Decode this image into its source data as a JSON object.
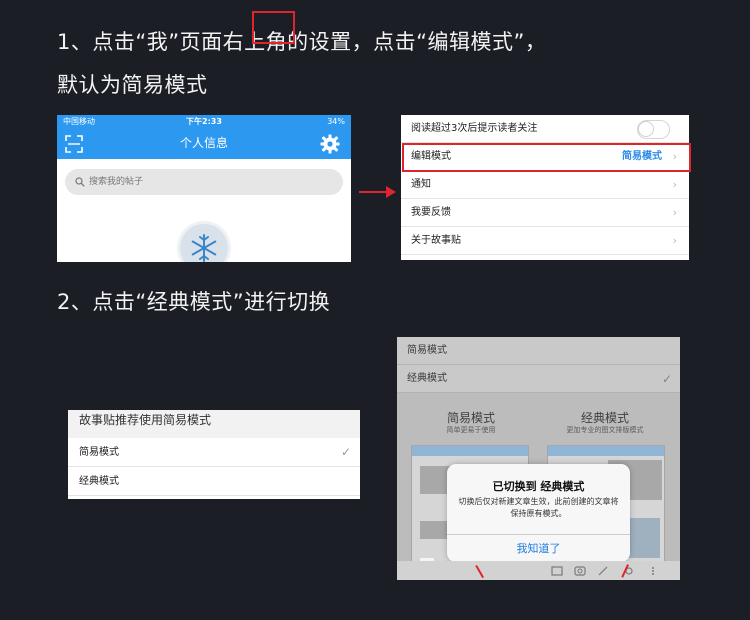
{
  "steps": {
    "step1_line1": "1、点击“我”页面右上角的设置，点击“编辑模式”，",
    "step1_line2": "默认为简易模式",
    "step2": "2、点击“经典模式”进行切换"
  },
  "profile_screen": {
    "status": {
      "carrier": "中国移动",
      "time": "下午2:33",
      "battery": "34%"
    },
    "title": "个人信息",
    "search_placeholder": "搜索我的帖子"
  },
  "settings_screen": {
    "rows": [
      {
        "label": "阅读超过3次后提示读者关注",
        "type": "toggle"
      },
      {
        "label": "编辑模式",
        "value": "简易模式",
        "type": "link"
      },
      {
        "label": "通知",
        "type": "link"
      },
      {
        "label": "我要反馈",
        "type": "link"
      },
      {
        "label": "关于故事贴",
        "type": "link"
      }
    ]
  },
  "mode_list": {
    "header": "故事贴推荐使用简易模式",
    "options": [
      "简易模式",
      "经典模式"
    ]
  },
  "switch_screen": {
    "rows": [
      "简易模式",
      "经典模式"
    ],
    "columns": [
      {
        "title": "简易模式",
        "subtitle": "简单更易于使用"
      },
      {
        "title": "经典模式",
        "subtitle": "更加专业的图文排版模式"
      }
    ],
    "dialog": {
      "title": "已切换到 经典模式",
      "message": "切换后仅对新建文章生效，此前创建的文章将保持原有模式。",
      "button": "我知道了"
    }
  },
  "colors": {
    "background": "#1c1e25",
    "accent_blue": "#2c98f0",
    "highlight_red": "#e1242b"
  }
}
